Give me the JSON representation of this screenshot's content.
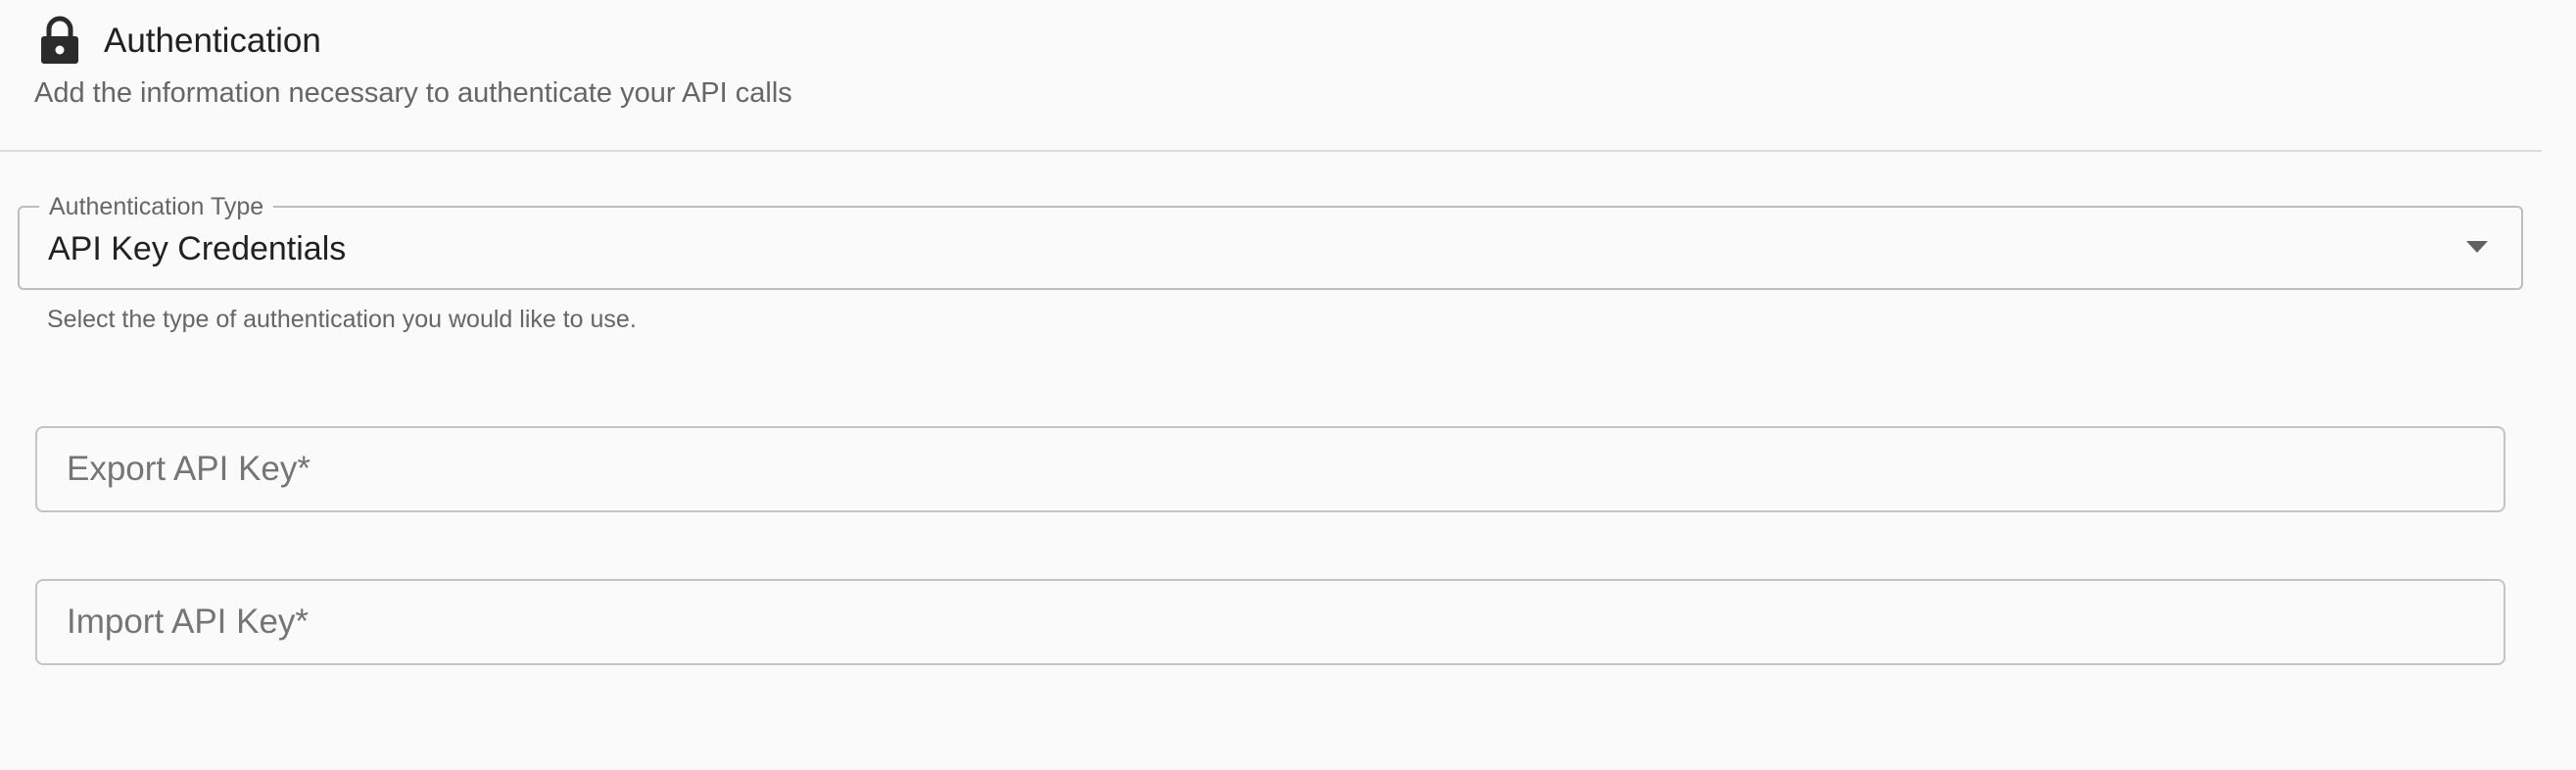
{
  "section": {
    "icon": "lock-icon",
    "title": "Authentication",
    "subtitle": "Add the information necessary to authenticate your API calls"
  },
  "auth_type": {
    "label": "Authentication Type",
    "selected": "API Key Credentials",
    "helper": "Select the type of authentication you would like to use."
  },
  "fields": {
    "export_key": {
      "placeholder": "Export API Key*",
      "value": ""
    },
    "import_key": {
      "placeholder": "Import API Key*",
      "value": ""
    }
  },
  "colors": {
    "background": "#fafafa",
    "text_primary": "#212121",
    "text_secondary": "#666666",
    "border": "#c4c4c4"
  }
}
